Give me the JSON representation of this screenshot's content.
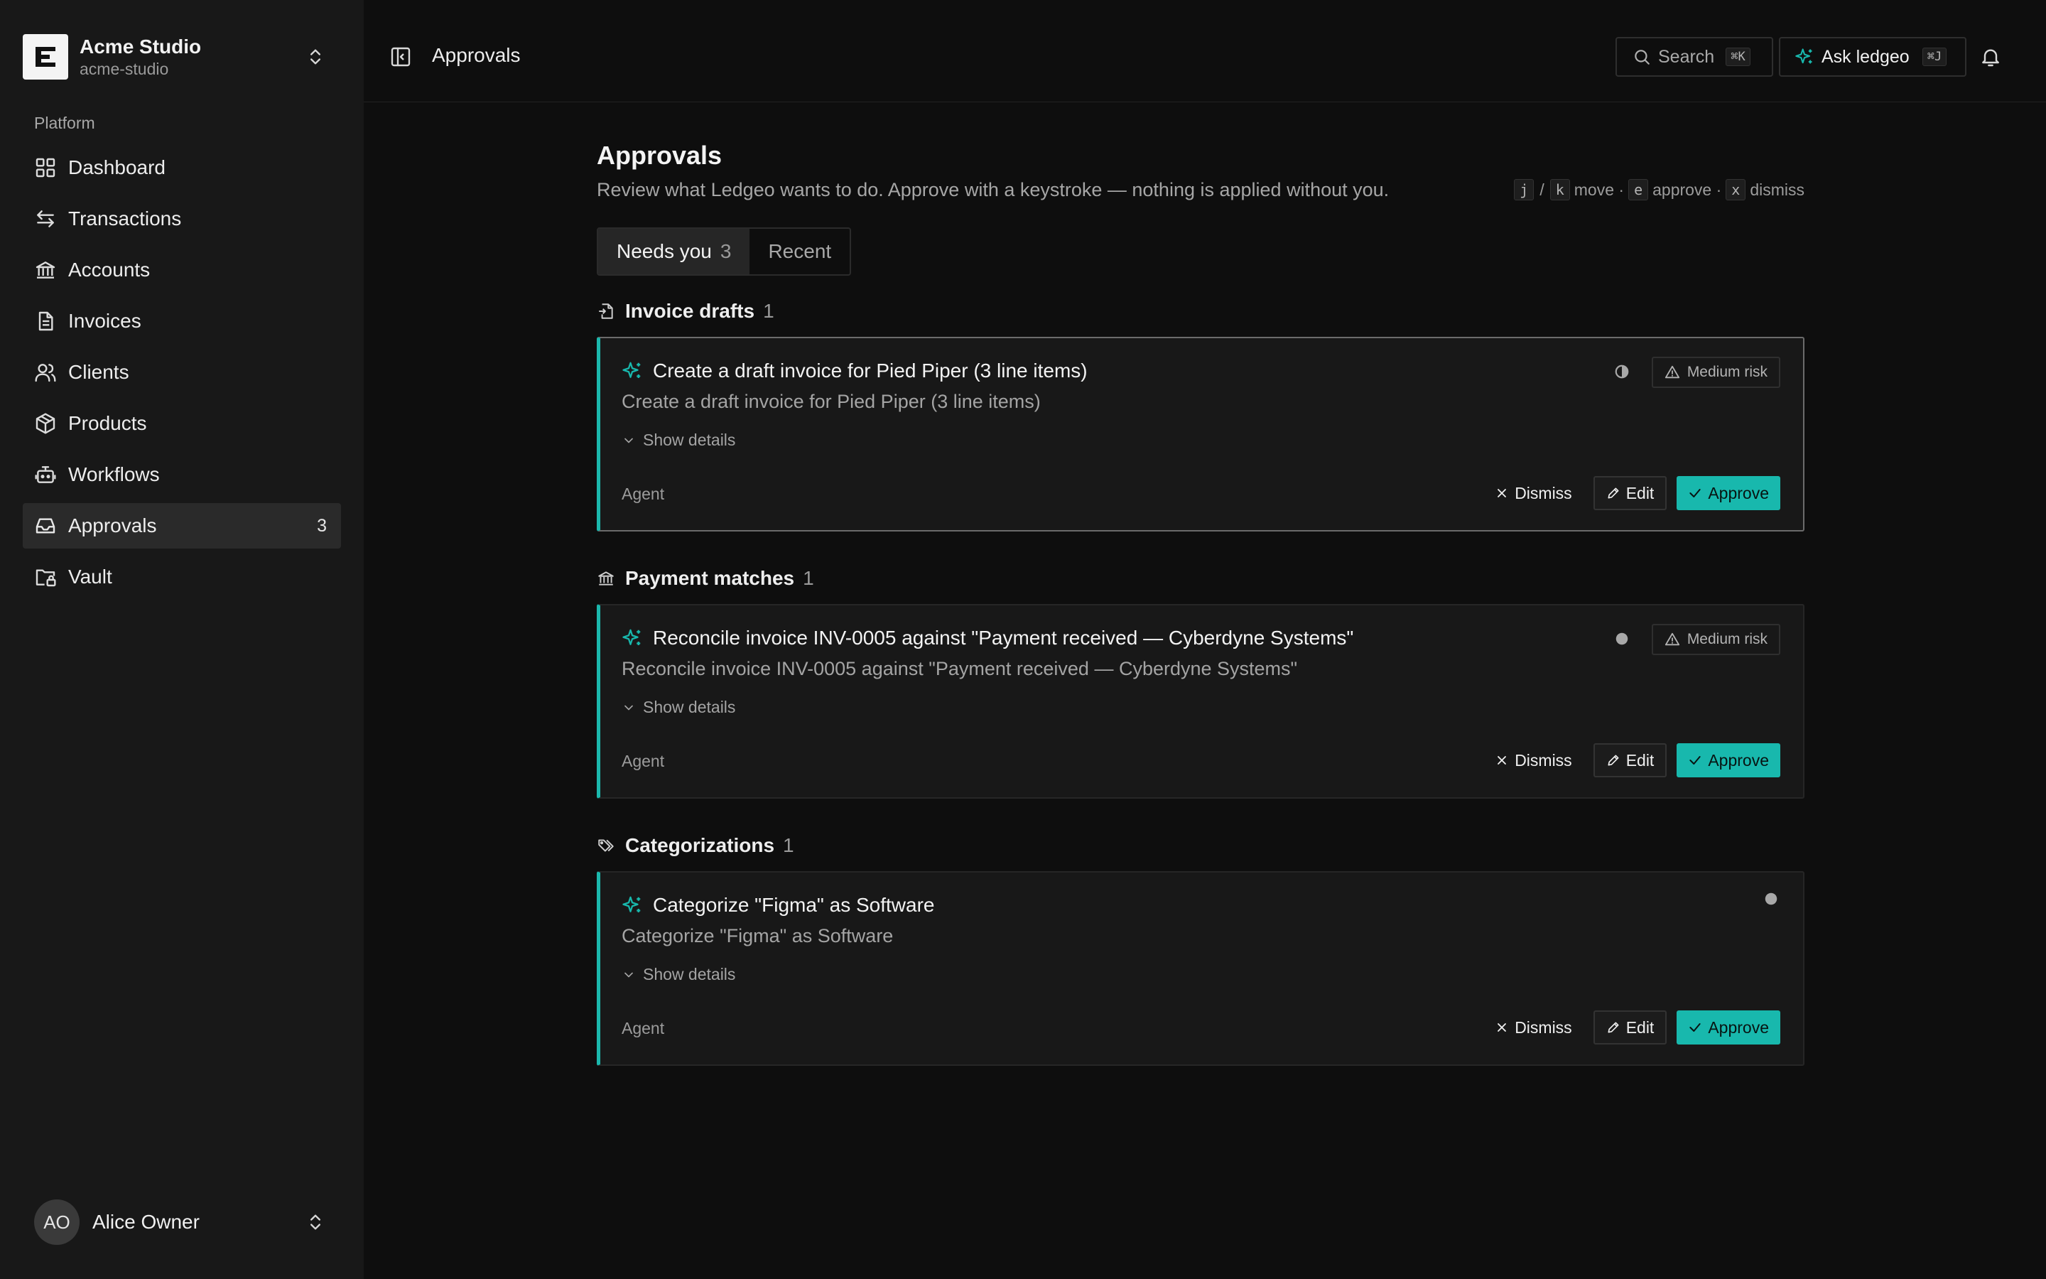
{
  "workspace": {
    "name": "Acme Studio",
    "slug": "acme-studio",
    "logo_letter": "E"
  },
  "sidebar": {
    "section": "Platform",
    "items": [
      {
        "label": "Dashboard",
        "icon": "grid-icon"
      },
      {
        "label": "Transactions",
        "icon": "arrows-icon"
      },
      {
        "label": "Accounts",
        "icon": "bank-icon"
      },
      {
        "label": "Invoices",
        "icon": "file-icon"
      },
      {
        "label": "Clients",
        "icon": "users-icon"
      },
      {
        "label": "Products",
        "icon": "box-icon"
      },
      {
        "label": "Workflows",
        "icon": "bot-icon"
      },
      {
        "label": "Approvals",
        "icon": "inbox-icon",
        "badge": "3",
        "active": true
      },
      {
        "label": "Vault",
        "icon": "folder-lock-icon"
      }
    ]
  },
  "user": {
    "initials": "AO",
    "name": "Alice Owner"
  },
  "topbar": {
    "title": "Approvals",
    "search_label": "Search",
    "search_shortcut": "⌘K",
    "ask_label": "Ask ledgeo",
    "ask_shortcut": "⌘J"
  },
  "page": {
    "title": "Approvals",
    "subtitle": "Review what Ledgeo wants to do. Approve with a keystroke — nothing is applied without you.",
    "hints": {
      "key_j": "j",
      "slash": "/",
      "key_k": "k",
      "move": "move ·",
      "key_e": "e",
      "approve": "approve ·",
      "key_x": "x",
      "dismiss": "dismiss"
    },
    "tabs": [
      {
        "label": "Needs you",
        "count": "3"
      },
      {
        "label": "Recent"
      }
    ]
  },
  "groups": [
    {
      "title": "Invoice drafts",
      "count": "1",
      "card": {
        "title": "Create a draft invoice for Pied Piper (3 line items)",
        "description": "Create a draft invoice for Pied Piper (3 line items)",
        "details": "Show details",
        "source": "Agent",
        "risk": "Medium risk",
        "status": "half-circle-icon"
      }
    },
    {
      "title": "Payment matches",
      "count": "1",
      "card": {
        "title": "Reconcile invoice INV-0005 against \"Payment received — Cyberdyne Systems\"",
        "description": "Reconcile invoice INV-0005 against \"Payment received — Cyberdyne Systems\"",
        "details": "Show details",
        "source": "Agent",
        "risk": "Medium risk",
        "status": "dot-icon"
      }
    },
    {
      "title": "Categorizations",
      "count": "1",
      "card": {
        "title": "Categorize \"Figma\" as Software",
        "description": "Categorize \"Figma\" as Software",
        "details": "Show details",
        "source": "Agent",
        "status": "dot-icon"
      }
    }
  ],
  "actions": {
    "dismiss": "Dismiss",
    "edit": "Edit",
    "approve": "Approve"
  },
  "colors": {
    "accent": "#18b8ad",
    "background": "#0e0e0e",
    "sidebar": "#181818",
    "card": "#181818"
  }
}
